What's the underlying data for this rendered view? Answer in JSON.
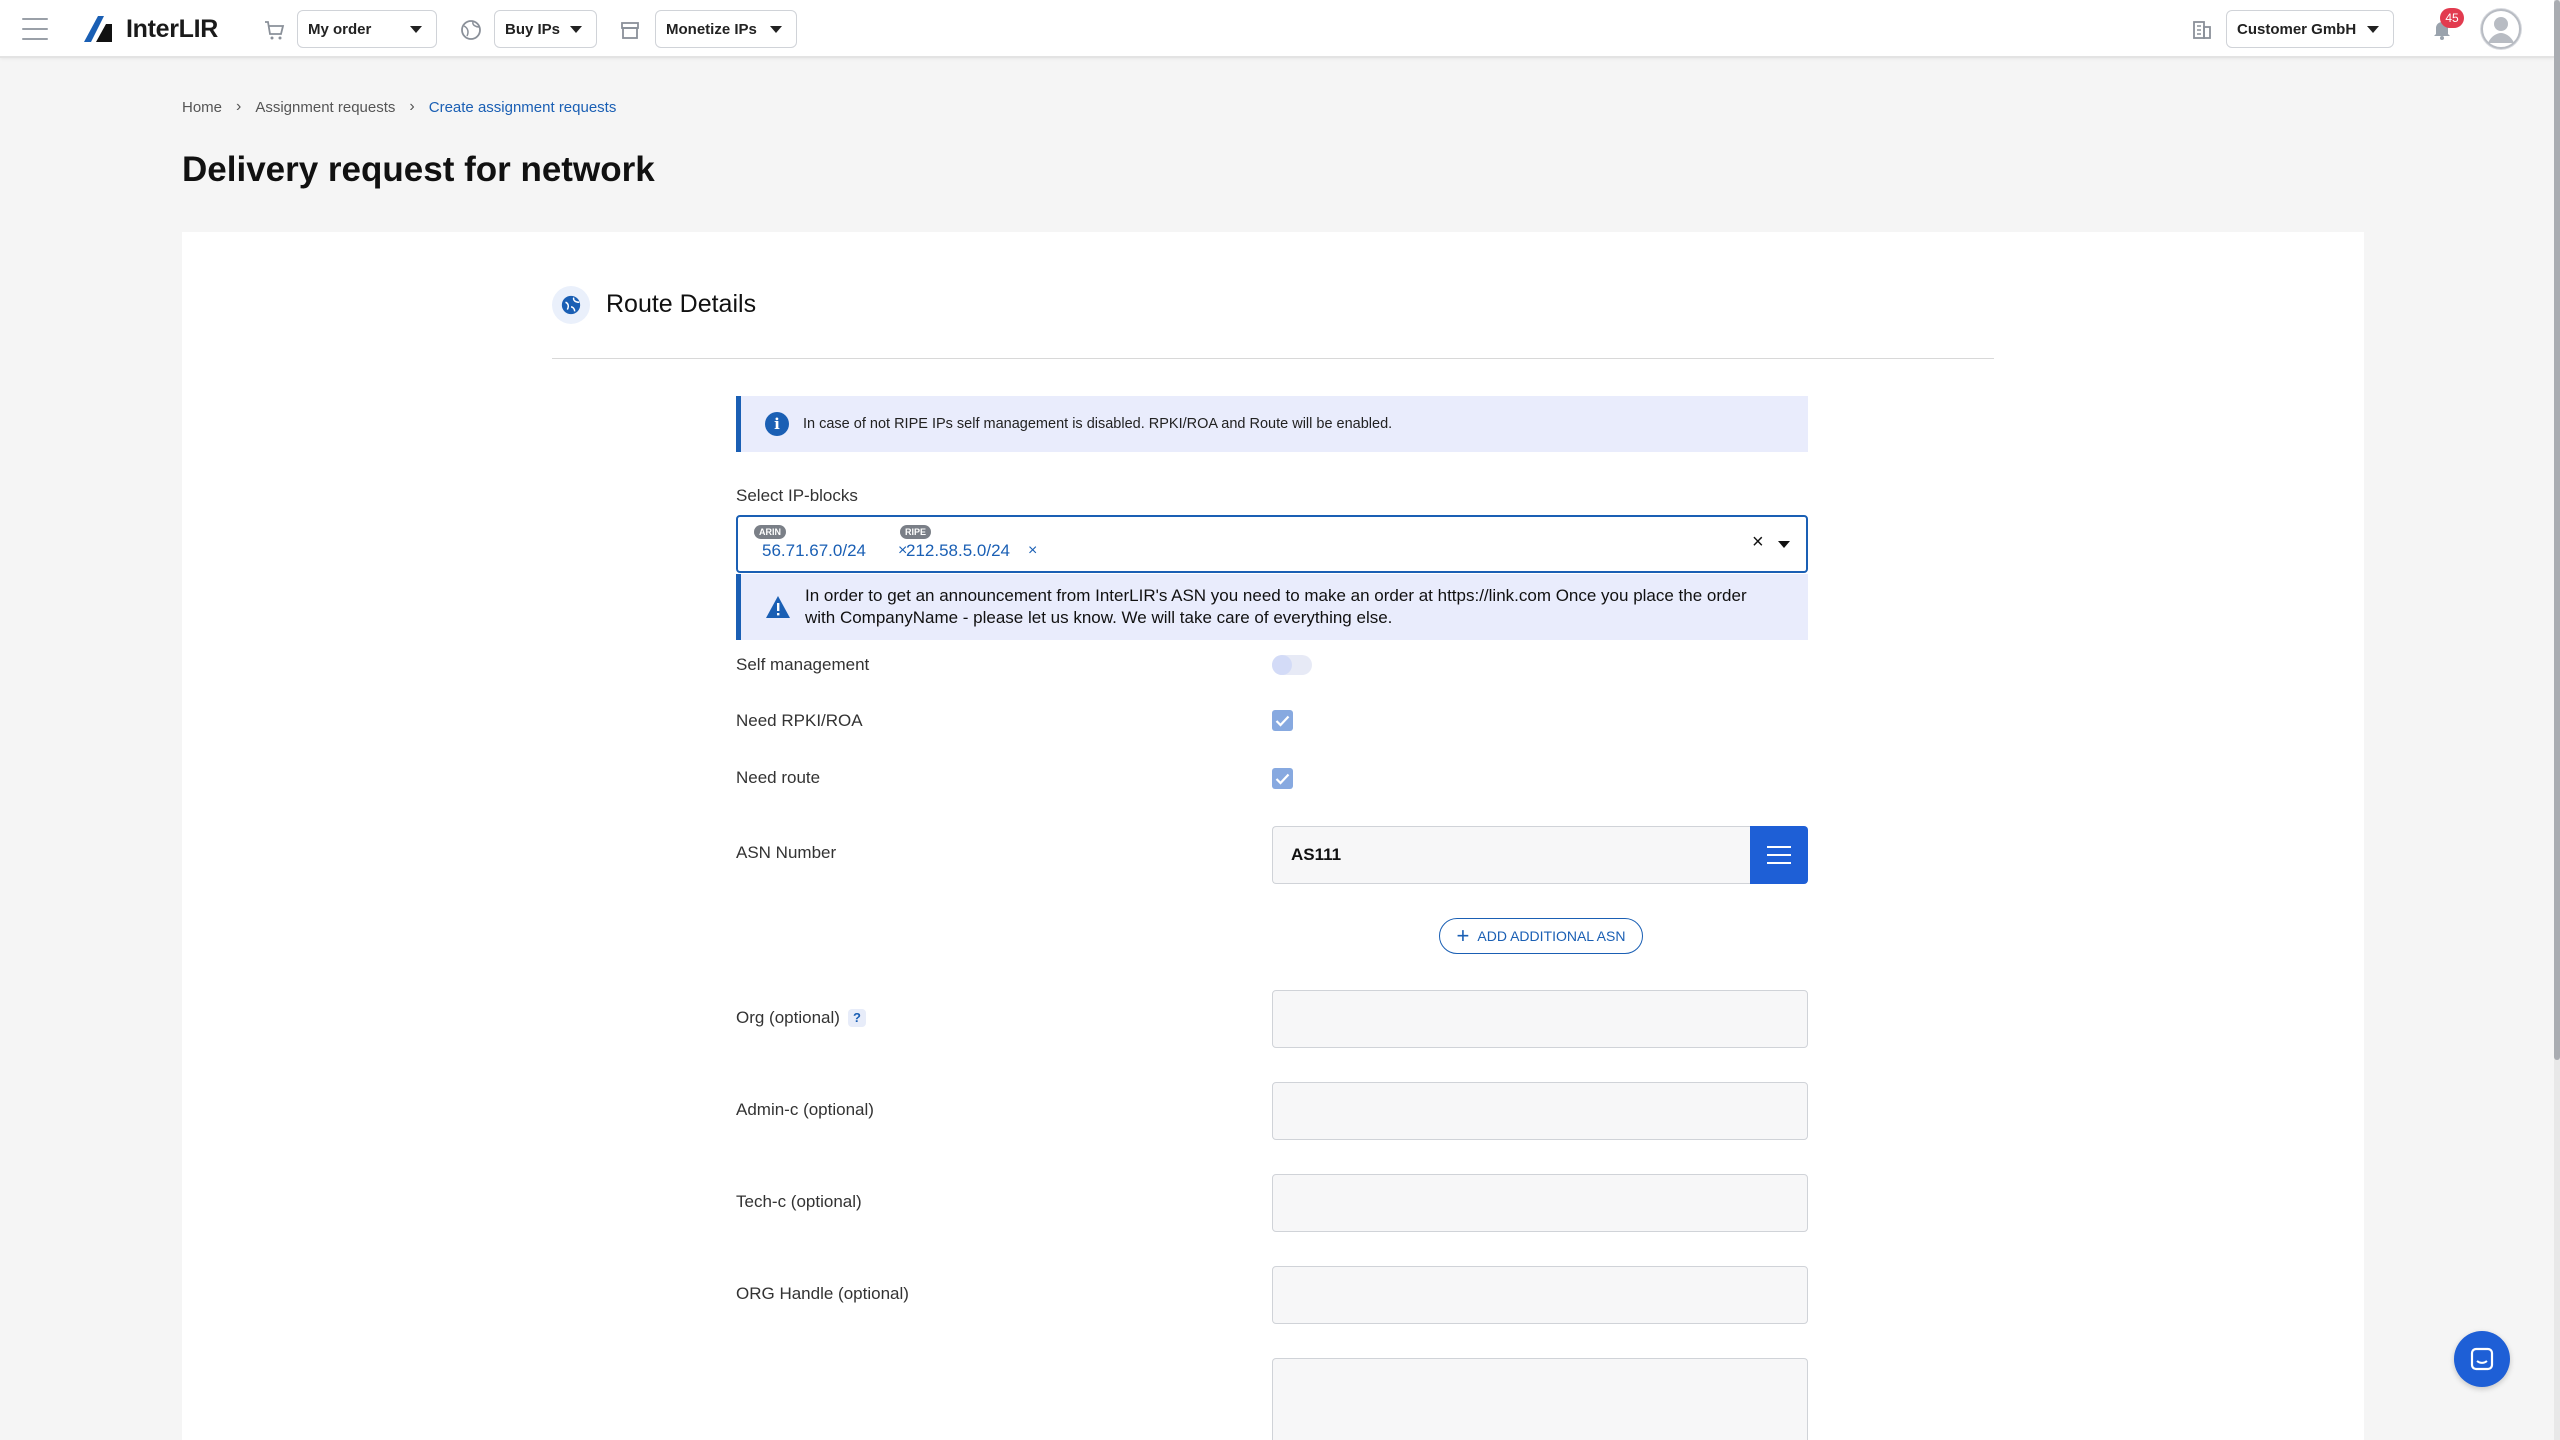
{
  "topbar": {
    "logo_text": "InterLIR",
    "my_order_label": "My order",
    "buy_ips_label": "Buy IPs",
    "monetize_ips_label": "Monetize IPs",
    "company_label": "Customer GmbH",
    "notification_count": "45"
  },
  "breadcrumb": {
    "home": "Home",
    "assignment_requests": "Assignment requests",
    "current": "Create assignment requests"
  },
  "page": {
    "title": "Delivery request for network"
  },
  "section": {
    "title": "Route Details"
  },
  "info_message": "In case of not RIPE IPs self management is disabled. RPKI/ROA and Route will be enabled.",
  "ip_blocks": {
    "label": "Select IP-blocks",
    "selected": [
      {
        "registry": "ARIN",
        "block": "56.71.67.0/24"
      },
      {
        "registry": "RIPE",
        "block": "212.58.5.0/24"
      }
    ],
    "clear_glyph": "×"
  },
  "warning_message": {
    "line1": "In order to get an announcement from InterLIR's ASN you need to make an order at https://link.com Once you place the order",
    "line2": "with CompanyName - please let us know. We will take care of everything else."
  },
  "form": {
    "self_management_label": "Self management",
    "self_management_on": false,
    "need_rpki_label": "Need RPKI/ROA",
    "need_rpki_checked": true,
    "need_route_label": "Need route",
    "need_route_checked": true,
    "asn_label": "ASN Number",
    "asn_value": "AS111",
    "add_asn_label": "ADD ADDITIONAL ASN",
    "org_label": "Org (optional)",
    "org_help": "?",
    "admin_c_label": "Admin-c (optional)",
    "tech_c_label": "Tech-c (optional)",
    "org_handle_label": "ORG Handle (optional)"
  },
  "colors": {
    "accent": "#1a5fb4",
    "button_blue": "#1e5fd6",
    "info_bg": "#e9ecfc",
    "badge_red": "#e23b4f"
  },
  "icons": [
    "hamburger-icon",
    "logo-icon",
    "cart-icon",
    "globe-icon",
    "store-icon",
    "building-icon",
    "bell-icon",
    "avatar",
    "info-icon",
    "warning-icon",
    "list-icon",
    "plus-icon",
    "chat-icon"
  ]
}
